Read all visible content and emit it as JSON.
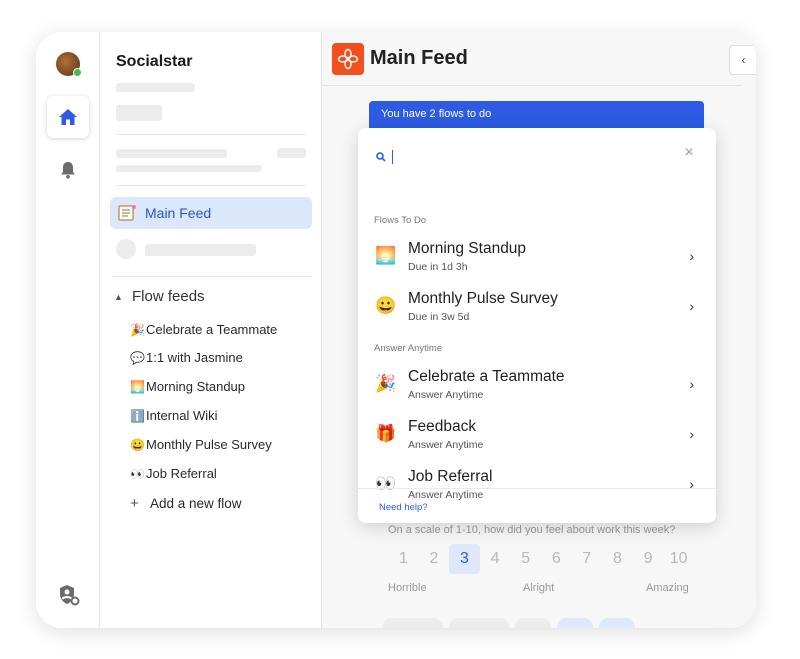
{
  "sidebar": {
    "brand": "Socialstar",
    "main_feed": "Main Feed",
    "flow_feeds_title": "Flow feeds",
    "flows": [
      {
        "icon": "🎉",
        "label": "Celebrate a Teammate"
      },
      {
        "icon": "💬",
        "label": "1:1 with Jasmine"
      },
      {
        "icon": "🌅",
        "label": "Morning Standup"
      },
      {
        "icon": "ℹ️",
        "label": "Internal Wiki"
      },
      {
        "icon": "😀",
        "label": "Monthly Pulse Survey"
      },
      {
        "icon": "👀",
        "label": "Job Referral"
      }
    ],
    "add_flow": "Add a new flow"
  },
  "main": {
    "title": "Main Feed",
    "banner": "You have 2 flows to do",
    "question": "On a scale of 1-10, how did you feel about work this week?",
    "scale": [
      "1",
      "2",
      "3",
      "4",
      "5",
      "6",
      "7",
      "8",
      "9",
      "10"
    ],
    "scale_selected": "3",
    "scale_low": "Horrible",
    "scale_mid": "Alright",
    "scale_high": "Amazing"
  },
  "dropdown": {
    "search_value": "",
    "to_do_label": "Flows To Do",
    "to_do": [
      {
        "icon": "🌅",
        "name": "Morning Standup",
        "sub": "Due in 1d 3h"
      },
      {
        "icon": "😀",
        "name": "Monthly Pulse Survey",
        "sub": "Due in 3w 5d"
      }
    ],
    "anytime_label": "Answer Anytime",
    "anytime": [
      {
        "icon": "🎉",
        "name": "Celebrate a Teammate",
        "sub": "Answer Anytime"
      },
      {
        "icon": "🎁",
        "name": "Feedback",
        "sub": "Answer Anytime"
      },
      {
        "icon": "👀",
        "name": "Job Referral",
        "sub": "Answer Anytime"
      }
    ],
    "help": "Need help?"
  },
  "colors": {
    "accent": "#2d5be3",
    "logo": "#f24e1e",
    "selected_nav": "#dbe7fb"
  }
}
